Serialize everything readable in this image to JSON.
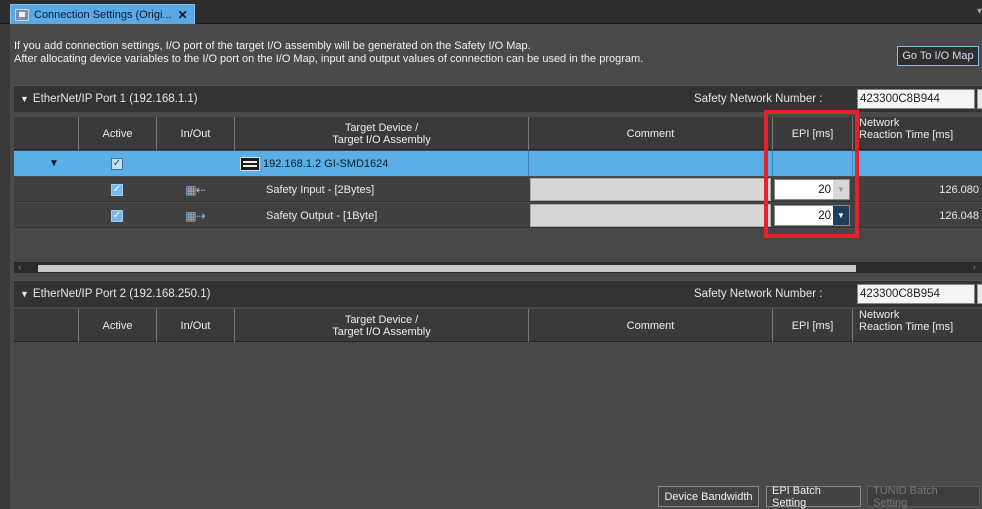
{
  "tab": {
    "title": "Connection Settings (Origi...",
    "close": "✕"
  },
  "info": {
    "line1": "If you add connection settings, I/O port of the target I/O assembly will be generated on the Safety I/O Map.",
    "line2": "After allocating device variables to the I/O port on the I/O Map, input and output values of connection can be used in the program."
  },
  "goto_button": "Go To I/O Map",
  "columns": {
    "active": "Active",
    "inout": "In/Out",
    "target_line1": "Target Device /",
    "target_line2": "Target I/O Assembly",
    "comment": "Comment",
    "epi": "EPI [ms]",
    "nrt_line1": "Network",
    "nrt_line2": "Reaction Time [ms]"
  },
  "port1": {
    "title": "EtherNet/IP Port 1 (192.168.1.1)",
    "snn_label": "Safety Network Number :",
    "snn_value": "423300C8B944",
    "snn_button": "...",
    "device_row": {
      "expander": "▼",
      "device": "192.168.1.2 GI-SMD1624"
    },
    "rows": [
      {
        "name": "Safety Input - [2Bytes]",
        "epi": "20",
        "nrt": "126.080",
        "io": "in"
      },
      {
        "name": "Safety Output - [1Byte]",
        "epi": "20",
        "nrt": "126.048",
        "io": "out"
      }
    ]
  },
  "port2": {
    "title": "EtherNet/IP Port 2 (192.168.250.1)",
    "snn_label": "Safety Network Number :",
    "snn_value": "423300C8B954",
    "snn_button": "..."
  },
  "bottom_buttons": {
    "device_bandwidth": "Device Bandwidth",
    "epi_batch": "EPI Batch Setting",
    "tunid_batch": "TUNID Batch Setting"
  },
  "colors": {
    "selected_row": "#59aee6",
    "highlight": "#e0242a"
  }
}
